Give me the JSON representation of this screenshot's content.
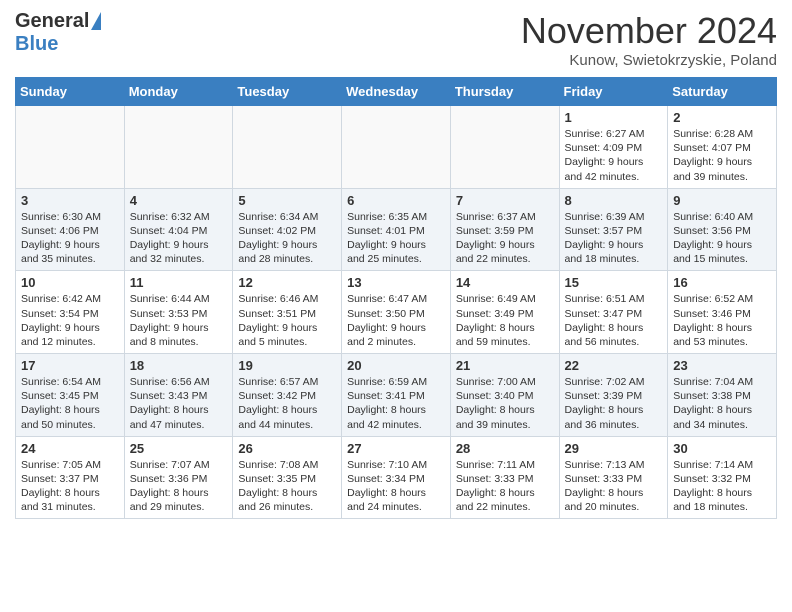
{
  "logo": {
    "general": "General",
    "blue": "Blue"
  },
  "header": {
    "month": "November 2024",
    "location": "Kunow, Swietokrzyskie, Poland"
  },
  "days_of_week": [
    "Sunday",
    "Monday",
    "Tuesday",
    "Wednesday",
    "Thursday",
    "Friday",
    "Saturday"
  ],
  "weeks": [
    [
      {
        "day": "",
        "info": ""
      },
      {
        "day": "",
        "info": ""
      },
      {
        "day": "",
        "info": ""
      },
      {
        "day": "",
        "info": ""
      },
      {
        "day": "",
        "info": ""
      },
      {
        "day": "1",
        "info": "Sunrise: 6:27 AM\nSunset: 4:09 PM\nDaylight: 9 hours and 42 minutes."
      },
      {
        "day": "2",
        "info": "Sunrise: 6:28 AM\nSunset: 4:07 PM\nDaylight: 9 hours and 39 minutes."
      }
    ],
    [
      {
        "day": "3",
        "info": "Sunrise: 6:30 AM\nSunset: 4:06 PM\nDaylight: 9 hours and 35 minutes."
      },
      {
        "day": "4",
        "info": "Sunrise: 6:32 AM\nSunset: 4:04 PM\nDaylight: 9 hours and 32 minutes."
      },
      {
        "day": "5",
        "info": "Sunrise: 6:34 AM\nSunset: 4:02 PM\nDaylight: 9 hours and 28 minutes."
      },
      {
        "day": "6",
        "info": "Sunrise: 6:35 AM\nSunset: 4:01 PM\nDaylight: 9 hours and 25 minutes."
      },
      {
        "day": "7",
        "info": "Sunrise: 6:37 AM\nSunset: 3:59 PM\nDaylight: 9 hours and 22 minutes."
      },
      {
        "day": "8",
        "info": "Sunrise: 6:39 AM\nSunset: 3:57 PM\nDaylight: 9 hours and 18 minutes."
      },
      {
        "day": "9",
        "info": "Sunrise: 6:40 AM\nSunset: 3:56 PM\nDaylight: 9 hours and 15 minutes."
      }
    ],
    [
      {
        "day": "10",
        "info": "Sunrise: 6:42 AM\nSunset: 3:54 PM\nDaylight: 9 hours and 12 minutes."
      },
      {
        "day": "11",
        "info": "Sunrise: 6:44 AM\nSunset: 3:53 PM\nDaylight: 9 hours and 8 minutes."
      },
      {
        "day": "12",
        "info": "Sunrise: 6:46 AM\nSunset: 3:51 PM\nDaylight: 9 hours and 5 minutes."
      },
      {
        "day": "13",
        "info": "Sunrise: 6:47 AM\nSunset: 3:50 PM\nDaylight: 9 hours and 2 minutes."
      },
      {
        "day": "14",
        "info": "Sunrise: 6:49 AM\nSunset: 3:49 PM\nDaylight: 8 hours and 59 minutes."
      },
      {
        "day": "15",
        "info": "Sunrise: 6:51 AM\nSunset: 3:47 PM\nDaylight: 8 hours and 56 minutes."
      },
      {
        "day": "16",
        "info": "Sunrise: 6:52 AM\nSunset: 3:46 PM\nDaylight: 8 hours and 53 minutes."
      }
    ],
    [
      {
        "day": "17",
        "info": "Sunrise: 6:54 AM\nSunset: 3:45 PM\nDaylight: 8 hours and 50 minutes."
      },
      {
        "day": "18",
        "info": "Sunrise: 6:56 AM\nSunset: 3:43 PM\nDaylight: 8 hours and 47 minutes."
      },
      {
        "day": "19",
        "info": "Sunrise: 6:57 AM\nSunset: 3:42 PM\nDaylight: 8 hours and 44 minutes."
      },
      {
        "day": "20",
        "info": "Sunrise: 6:59 AM\nSunset: 3:41 PM\nDaylight: 8 hours and 42 minutes."
      },
      {
        "day": "21",
        "info": "Sunrise: 7:00 AM\nSunset: 3:40 PM\nDaylight: 8 hours and 39 minutes."
      },
      {
        "day": "22",
        "info": "Sunrise: 7:02 AM\nSunset: 3:39 PM\nDaylight: 8 hours and 36 minutes."
      },
      {
        "day": "23",
        "info": "Sunrise: 7:04 AM\nSunset: 3:38 PM\nDaylight: 8 hours and 34 minutes."
      }
    ],
    [
      {
        "day": "24",
        "info": "Sunrise: 7:05 AM\nSunset: 3:37 PM\nDaylight: 8 hours and 31 minutes."
      },
      {
        "day": "25",
        "info": "Sunrise: 7:07 AM\nSunset: 3:36 PM\nDaylight: 8 hours and 29 minutes."
      },
      {
        "day": "26",
        "info": "Sunrise: 7:08 AM\nSunset: 3:35 PM\nDaylight: 8 hours and 26 minutes."
      },
      {
        "day": "27",
        "info": "Sunrise: 7:10 AM\nSunset: 3:34 PM\nDaylight: 8 hours and 24 minutes."
      },
      {
        "day": "28",
        "info": "Sunrise: 7:11 AM\nSunset: 3:33 PM\nDaylight: 8 hours and 22 minutes."
      },
      {
        "day": "29",
        "info": "Sunrise: 7:13 AM\nSunset: 3:33 PM\nDaylight: 8 hours and 20 minutes."
      },
      {
        "day": "30",
        "info": "Sunrise: 7:14 AM\nSunset: 3:32 PM\nDaylight: 8 hours and 18 minutes."
      }
    ]
  ]
}
